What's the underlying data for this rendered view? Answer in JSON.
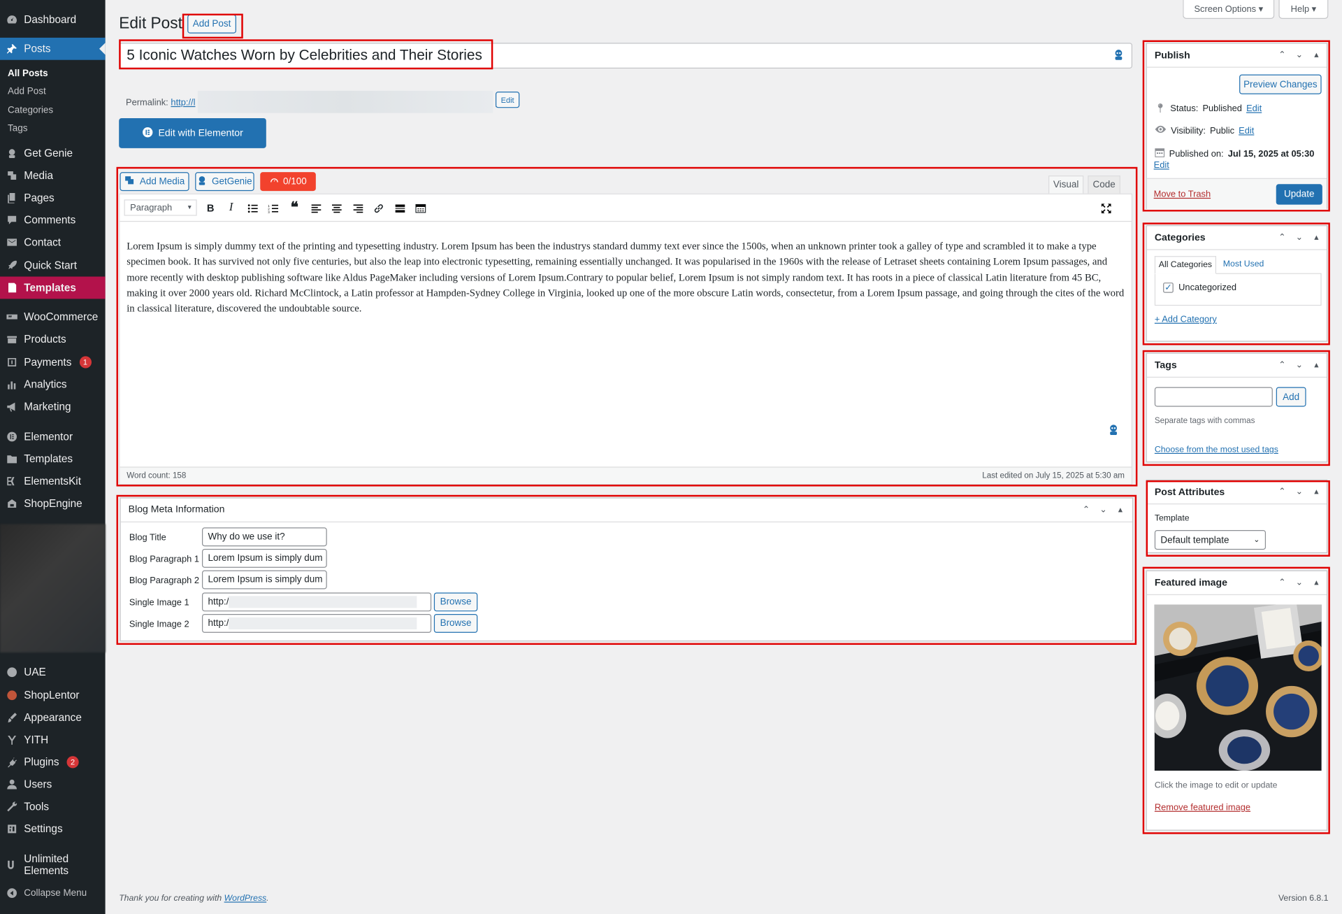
{
  "colors": {
    "accent": "#2271b1",
    "menu_bg": "#1d2327",
    "danger": "#d63638",
    "outline": "#e00000"
  },
  "sidebar": {
    "items": [
      {
        "label": "Dashboard",
        "icon": "dashboard-icon"
      },
      {
        "label": "Posts",
        "icon": "pin-icon"
      },
      {
        "label": "Get Genie",
        "icon": "genie-icon"
      },
      {
        "label": "Media",
        "icon": "media-icon"
      },
      {
        "label": "Pages",
        "icon": "pages-icon"
      },
      {
        "label": "Comments",
        "icon": "comment-icon"
      },
      {
        "label": "Contact",
        "icon": "mail-icon"
      },
      {
        "label": "Quick Start",
        "icon": "rocket-icon"
      },
      {
        "label": "Templates",
        "icon": "template-icon"
      },
      {
        "label": "WooCommerce",
        "icon": "woo-icon"
      },
      {
        "label": "Products",
        "icon": "products-icon"
      },
      {
        "label": "Payments",
        "icon": "payments-icon",
        "badge": "1"
      },
      {
        "label": "Analytics",
        "icon": "analytics-icon"
      },
      {
        "label": "Marketing",
        "icon": "megaphone-icon"
      },
      {
        "label": "Elementor",
        "icon": "elementor-icon"
      },
      {
        "label": "Templates",
        "icon": "folder-icon"
      },
      {
        "label": "ElementsKit",
        "icon": "elementskit-icon"
      },
      {
        "label": "ShopEngine",
        "icon": "shopengine-icon"
      },
      {
        "label": "UAE",
        "icon": "uae-icon"
      },
      {
        "label": "ShopLentor",
        "icon": "shoplentor-icon"
      },
      {
        "label": "Appearance",
        "icon": "brush-icon"
      },
      {
        "label": "YITH",
        "icon": "yith-icon"
      },
      {
        "label": "Plugins",
        "icon": "plugin-icon",
        "badge": "2"
      },
      {
        "label": "Users",
        "icon": "user-icon"
      },
      {
        "label": "Tools",
        "icon": "wrench-icon"
      },
      {
        "label": "Settings",
        "icon": "settings-icon"
      }
    ],
    "posts_sub": [
      "All Posts",
      "Add Post",
      "Categories",
      "Tags"
    ],
    "unlimited": "Unlimited",
    "unlimited2": "Elements",
    "collapse": "Collapse Menu"
  },
  "top": {
    "screen_options": "Screen Options ▾",
    "help": "Help ▾"
  },
  "header": {
    "title": "Edit Post",
    "add_post": "Add Post"
  },
  "post": {
    "title": "5 Iconic Watches Worn by Celebrities and Their Stories",
    "permalink_label": "Permalink:",
    "permalink_url": "http://l",
    "permalink_tail": "/",
    "edit": "Edit",
    "elementor": "Edit with Elementor"
  },
  "editor": {
    "add_media": "Add Media",
    "getgenie": "GetGenie",
    "score": "0/100",
    "tab_visual": "Visual",
    "tab_code": "Code",
    "format": "Paragraph",
    "content": "Lorem Ipsum is simply dummy text of the printing and typesetting industry. Lorem Ipsum has been the industrys standard dummy text ever since the 1500s, when an unknown printer took a galley of type and scrambled it to make a type specimen book. It has survived not only five centuries, but also the leap into electronic typesetting, remaining essentially unchanged. It was popularised in the 1960s with the release of Letraset sheets containing Lorem Ipsum passages, and more recently with desktop publishing software like Aldus PageMaker including versions of Lorem Ipsum.Contrary to popular belief, Lorem Ipsum is not simply random text. It has roots in a piece of classical Latin literature from 45 BC, making it over 2000 years old. Richard McClintock, a Latin professor at Hampden-Sydney College in Virginia, looked up one of the more obscure Latin words, consectetur, from a Lorem Ipsum passage, and going through the cites of the word in classical literature, discovered the undoubtable source.",
    "word_count": "Word count: 158",
    "last_edited": "Last edited on July 15, 2025 at 5:30 am"
  },
  "meta": {
    "title": "Blog Meta Information",
    "rows": [
      {
        "label": "Blog Title",
        "value": "Why do we use it?"
      },
      {
        "label": "Blog Paragraph 1",
        "value": "Lorem Ipsum is simply dum"
      },
      {
        "label": "Blog Paragraph 2",
        "value": "Lorem Ipsum is simply dum"
      },
      {
        "label": "Single Image 1",
        "value": "http:/"
      },
      {
        "label": "Single Image 2",
        "value": "http:/"
      }
    ],
    "browse": "Browse"
  },
  "publish": {
    "title": "Publish",
    "preview": "Preview Changes",
    "status_label": "Status:",
    "status": "Published",
    "visibility_label": "Visibility:",
    "visibility": "Public",
    "published_label": "Published on:",
    "published": "Jul 15, 2025 at 05:30",
    "edit": "Edit",
    "trash": "Move to Trash",
    "update": "Update"
  },
  "categories": {
    "title": "Categories",
    "tab_all": "All Categories",
    "tab_used": "Most Used",
    "item": "Uncategorized",
    "item_checked": true,
    "add": "+ Add Category"
  },
  "tags": {
    "title": "Tags",
    "add": "Add",
    "hint": "Separate tags with commas",
    "choose": "Choose from the most used tags"
  },
  "attributes": {
    "title": "Post Attributes",
    "template_label": "Template",
    "template": "Default template"
  },
  "featured": {
    "title": "Featured image",
    "hint": "Click the image to edit or update",
    "remove": "Remove featured image"
  },
  "footer": {
    "thanks": "Thank you for creating with",
    "wp": "WordPress",
    "dot": ".",
    "version": "Version 6.8.1"
  }
}
